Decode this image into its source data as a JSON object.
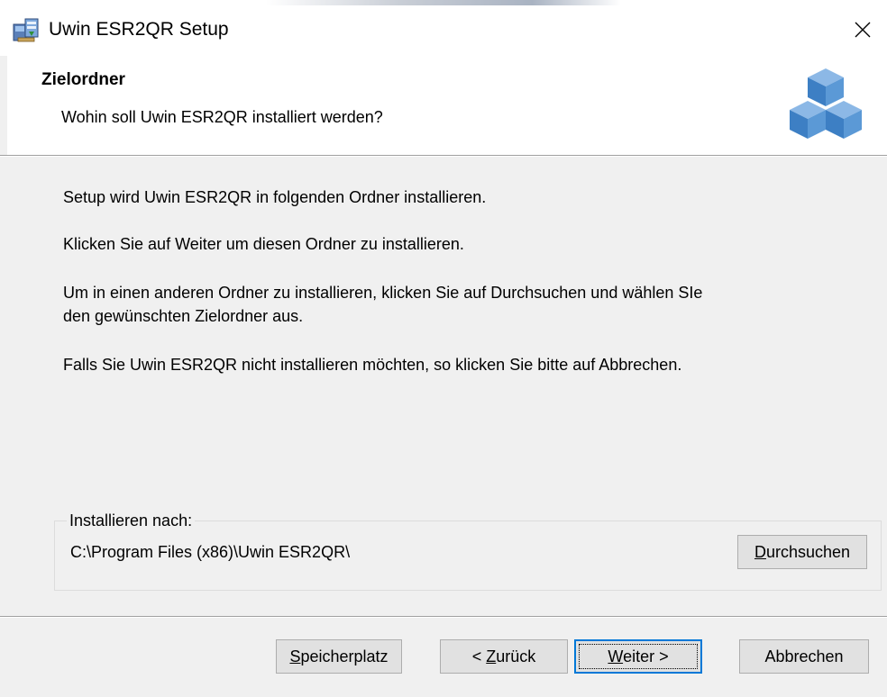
{
  "window": {
    "title": "Uwin ESR2QR Setup"
  },
  "header": {
    "title": "Zielordner",
    "subtitle": "Wohin soll Uwin ESR2QR installiert werden?"
  },
  "body": {
    "p1": "Setup wird Uwin ESR2QR in folgenden Ordner installieren.",
    "p2": "Klicken Sie auf Weiter um diesen Ordner zu installieren.",
    "p3_line1": "Um in einen anderen Ordner zu installieren, klicken Sie auf Durchsuchen und wählen SIe",
    "p3_line2": "den gewünschten Zielordner aus.",
    "p4": "Falls Sie Uwin ESR2QR nicht installieren möchten, so klicken Sie bitte auf Abbrechen."
  },
  "install_group": {
    "legend": "Installieren nach:",
    "path": "C:\\Program Files (x86)\\Uwin ESR2QR\\",
    "browse_first": "D",
    "browse_rest": "urchsuchen"
  },
  "buttons": {
    "space_first": "S",
    "space_rest": "peicherplatz",
    "back_pre": "< ",
    "back_first": "Z",
    "back_rest": "urück",
    "next_first": "W",
    "next_rest": "eiter >",
    "cancel": "Abbrechen"
  },
  "colors": {
    "accent": "#0078d7",
    "logo_blue": "#3d7fc4"
  },
  "icons": {
    "app": "installer-icon",
    "close": "close-icon",
    "logo": "cubes-logo-icon"
  }
}
